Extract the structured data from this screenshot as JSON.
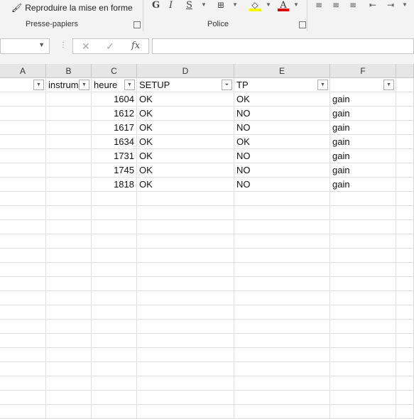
{
  "ribbon": {
    "format_painter_label": "Reproduire la mise en forme",
    "group_clipboard": "Presse-papiers",
    "group_font": "Police",
    "bold": "G",
    "italic": "I",
    "underline": "S"
  },
  "formula_bar": {
    "cancel_glyph": "✕",
    "enter_glyph": "✓",
    "fx_glyph": "fx",
    "name_box_value": "",
    "formula_value": ""
  },
  "columns": [
    "A",
    "B",
    "C",
    "D",
    "E",
    "F"
  ],
  "header_row": [
    "",
    "instrum",
    "heure",
    "SETUP",
    "TP",
    ""
  ],
  "rows": [
    [
      "",
      "",
      "1604",
      "OK",
      "OK",
      "gain"
    ],
    [
      "",
      "",
      "1612",
      "OK",
      "NO",
      "gain"
    ],
    [
      "",
      "",
      "1617",
      "OK",
      "NO",
      "gain"
    ],
    [
      "",
      "",
      "1634",
      "OK",
      "OK",
      "gain"
    ],
    [
      "",
      "",
      "1731",
      "OK",
      "NO",
      "gain"
    ],
    [
      "",
      "",
      "1745",
      "OK",
      "NO",
      "gain"
    ],
    [
      "",
      "",
      "1818",
      "OK",
      "NO",
      "gain"
    ]
  ],
  "colors": {
    "highlight": "#ffff00",
    "font_color": "#e00000"
  }
}
